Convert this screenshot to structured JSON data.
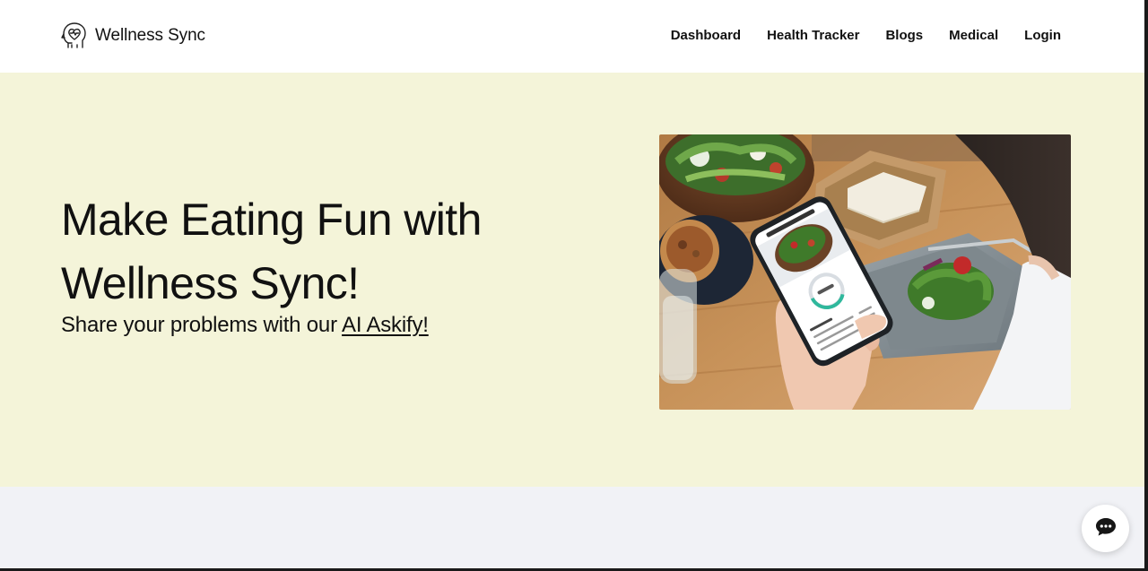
{
  "brand": {
    "name": "Wellness Sync",
    "logo_icon": "head-heart-icon"
  },
  "nav": {
    "items": [
      {
        "label": "Dashboard"
      },
      {
        "label": "Health Tracker"
      },
      {
        "label": "Blogs"
      },
      {
        "label": "Medical"
      },
      {
        "label": "Login"
      }
    ]
  },
  "hero": {
    "title_line1": "Make Eating Fun with",
    "title_line2": "Wellness Sync!",
    "subtitle_prefix": "Share your problems with our ",
    "subtitle_link": "AI Askify!",
    "image_icon": "diet-tracker-photo"
  },
  "chat": {
    "icon": "chat-bubble-icon"
  },
  "colors": {
    "hero_background": "#f4f4d9",
    "lower_background": "#f1f2f6",
    "text": "#111111"
  }
}
